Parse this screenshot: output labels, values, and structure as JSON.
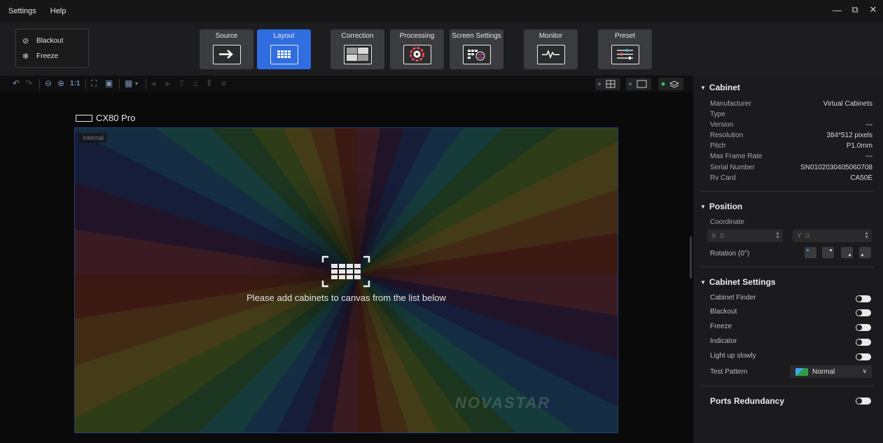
{
  "menu": {
    "settings": "Settings",
    "help": "Help"
  },
  "window_controls": {
    "minimize": "—",
    "restore": "⧉",
    "close": "✕"
  },
  "quick": {
    "blackout": "Blackout",
    "freeze": "Freeze"
  },
  "tabs": [
    {
      "label": "Source",
      "icon": "arrow-right-icon"
    },
    {
      "label": "Layout",
      "icon": "grid-icon",
      "active": true
    },
    {
      "label": "Correction",
      "icon": "correction-icon"
    },
    {
      "label": "Processing",
      "icon": "color-wheel-icon"
    },
    {
      "label": "Screen Settings",
      "icon": "screen-settings-icon"
    },
    {
      "label": "Monitor",
      "icon": "monitor-pulse-icon"
    },
    {
      "label": "Preset",
      "icon": "sliders-icon"
    }
  ],
  "canvas_toolbar": {
    "zoom_label": "1:1"
  },
  "canvas": {
    "controller": "CX80 Pro",
    "screen_tag": "Internal",
    "hint": "Please add cabinets to canvas from the list below",
    "watermark": "NOVASTAR"
  },
  "panel": {
    "cabinet": {
      "title": "Cabinet",
      "rows": [
        {
          "k": "Manufacturer",
          "v": "Virtual Cabinets"
        },
        {
          "k": "Type",
          "v": ""
        },
        {
          "k": "Version",
          "v": "---"
        },
        {
          "k": "Resolution",
          "v": "384*512 pixels"
        },
        {
          "k": "Pitch",
          "v": "P1.0mm"
        },
        {
          "k": "Max Frame Rate",
          "v": "---"
        },
        {
          "k": "Serial Number",
          "v": "SN0102030405060708"
        },
        {
          "k": "Rv Card",
          "v": "CA50E"
        }
      ]
    },
    "position": {
      "title": "Position",
      "coordinate_label": "Coordinate",
      "x_label": "X",
      "x_value": "0",
      "y_label": "Y",
      "y_value": "0",
      "rotation_label": "Rotation (0°)"
    },
    "cabinet_settings": {
      "title": "Cabinet Settings",
      "items": [
        "Cabinet Finder",
        "Blackout",
        "Freeze",
        "Indicator",
        "Light up slowly"
      ],
      "test_pattern_label": "Test Pattern",
      "test_pattern_value": "Normal"
    },
    "ports": {
      "title": "Ports Redundancy"
    }
  },
  "colors": {
    "accent": "#2f6de0",
    "screen_border": "#3c6ee8"
  }
}
